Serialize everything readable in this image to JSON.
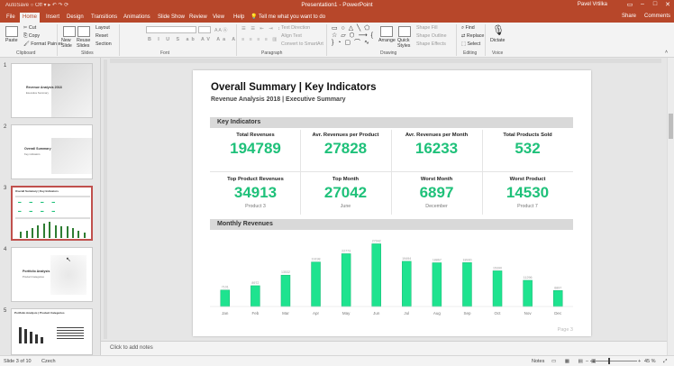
{
  "window": {
    "title": "Presentation1 - PowerPoint",
    "user": "Pavel Vrtilka",
    "qat": "AutoSave ○ Off ▾ ▸ ↶ ↷ ⟳"
  },
  "tabs": [
    "File",
    "Home",
    "Insert",
    "Design",
    "Transitions",
    "Animations",
    "Slide Show",
    "Review",
    "View",
    "Help"
  ],
  "tell_me": "Tell me what you want to do",
  "share": "Share",
  "comments": "Comments",
  "ribbon": {
    "groups": [
      "Clipboard",
      "Slides",
      "Font",
      "Paragraph",
      "Drawing",
      "Editing",
      "Voice"
    ],
    "clipboard": {
      "paste": "Paste",
      "cut": "Cut",
      "copy": "Copy",
      "format_painter": "Format Painter"
    },
    "slides": {
      "new_slide": "New Slide",
      "reuse_slides": "Reuse Slides",
      "layout": "Layout",
      "reset": "Reset",
      "section": "Section"
    },
    "paragraph": {
      "text_direction": "Text Direction",
      "align_text": "Align Text",
      "convert_smartart": "Convert to SmartArt"
    },
    "drawing": {
      "arrange": "Arrange",
      "quick_styles": "Quick Styles",
      "shape_fill": "Shape Fill",
      "shape_outline": "Shape Outline",
      "shape_effects": "Shape Effects"
    },
    "editing": {
      "find": "Find",
      "replace": "Replace",
      "select": "Select"
    },
    "voice": {
      "dictate": "Dictate"
    }
  },
  "thumbnails": [
    {
      "num": "1",
      "title": "Revenue Analysis 2018",
      "sub": "Executive Summary"
    },
    {
      "num": "2",
      "title": "Overall Summary",
      "sub": "Key indicators"
    },
    {
      "num": "3",
      "title": "Overall Summary | Key Indicators",
      "sub": ""
    },
    {
      "num": "4",
      "title": "Portfolio Analysis",
      "sub": "Product Categories"
    },
    {
      "num": "5",
      "title": "Portfolio Analysis | Product Categories",
      "sub": ""
    }
  ],
  "slide": {
    "title": "Overall Summary | Key Indicators",
    "subtitle": "Revenue Analysis 2018 | Executive Summary",
    "section_kpi": "Key Indicators",
    "section_monthly": "Monthly Revenues",
    "kpis_row1": [
      {
        "label": "Total Revenues",
        "value": "194789"
      },
      {
        "label": "Avr. Revenues per Product",
        "value": "27828"
      },
      {
        "label": "Avr. Revenues per Month",
        "value": "16233"
      },
      {
        "label": "Total Products Sold",
        "value": "532"
      }
    ],
    "kpis_row2": [
      {
        "label": "Top Product Revenues",
        "value": "34913",
        "sub": "Product 3"
      },
      {
        "label": "Top Month",
        "value": "27042",
        "sub": "June"
      },
      {
        "label": "Worst Month",
        "value": "6897",
        "sub": "December"
      },
      {
        "label": "Worst Product",
        "value": "14530",
        "sub": "Product 7"
      }
    ],
    "page": "Page 3"
  },
  "chart_data": {
    "type": "bar",
    "categories": [
      "Jan",
      "Feb",
      "Mar",
      "Apr",
      "May",
      "Jun",
      "Jul",
      "Aug",
      "Sep",
      "Oct",
      "Nov",
      "Dec"
    ],
    "values": [
      7101,
      8972,
      13532,
      19198,
      22773,
      27042,
      19494,
      18867,
      18930,
      15390,
      11296,
      6897
    ],
    "ylim": [
      0,
      28000
    ],
    "bar_color": "#1ee38f"
  },
  "notes_placeholder": "Click to add notes",
  "status": {
    "slide_info": "Slide 3 of 10",
    "language": "Czech",
    "notes": "Notes",
    "zoom": "45 %"
  },
  "colors": {
    "accent": "#b7472a",
    "kpi": "#1fc17a"
  }
}
